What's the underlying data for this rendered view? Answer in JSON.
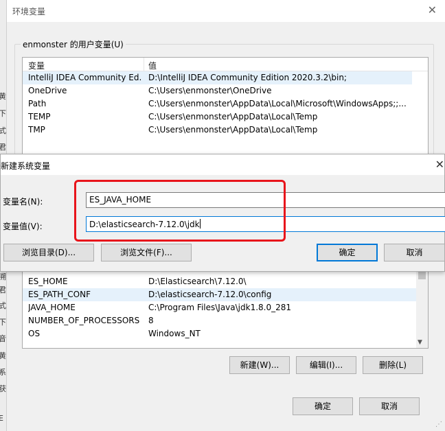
{
  "background_window": {
    "title": "环境变量",
    "user_group_label": "enmonster 的用户变量(U)",
    "columns": [
      "变量",
      "值"
    ],
    "user_vars": [
      {
        "name": "IntelliJ IDEA Community Ed...",
        "value": "D:\\IntelliJ IDEA Community Edition 2020.3.2\\bin;"
      },
      {
        "name": "OneDrive",
        "value": "C:\\Users\\enmonster\\OneDrive"
      },
      {
        "name": "Path",
        "value": "C:\\Users\\enmonster\\AppData\\Local\\Microsoft\\WindowsApps;;..."
      },
      {
        "name": "TEMP",
        "value": "C:\\Users\\enmonster\\AppData\\Local\\Temp"
      },
      {
        "name": "TMP",
        "value": "C:\\Users\\enmonster\\AppData\\Local\\Temp"
      }
    ],
    "system_vars": [
      {
        "name": "ES_HOME",
        "value": "D:\\Elasticsearch\\7.12.0\\"
      },
      {
        "name": "ES_PATH_CONF",
        "value": "D:\\elasticsearch-7.12.0\\config"
      },
      {
        "name": "JAVA_HOME",
        "value": "C:\\Program Files\\Java\\jdk1.8.0_281"
      },
      {
        "name": "NUMBER_OF_PROCESSORS",
        "value": "8"
      },
      {
        "name": "OS",
        "value": "Windows_NT"
      }
    ],
    "system_buttons": {
      "new": "新建(W)...",
      "edit": "编辑(I)...",
      "delete": "删除(L)"
    },
    "footer_buttons": {
      "ok": "确定",
      "cancel": "取消"
    }
  },
  "new_var_dialog": {
    "title": "新建系统变量",
    "name_label": "变量名(N):",
    "value_label": "变量值(V):",
    "name_value": "ES_JAVA_HOME",
    "value_value": "D:\\elasticsearch-7.12.0\\jdk",
    "buttons": {
      "browse_dir": "浏览目录(D)...",
      "browse_file": "浏览文件(F)...",
      "ok": "确定",
      "cancel": "取消"
    }
  },
  "background_edge_chars": [
    "黄",
    "下",
    "式",
    "君",
    "溯",
    "君",
    "式",
    "下",
    "音",
    "黄",
    "系",
    "获",
    "E"
  ],
  "colors": {
    "highlight_box": "#e8141b",
    "focus": "#0078d7",
    "selected_row": "#e5f1fb"
  }
}
